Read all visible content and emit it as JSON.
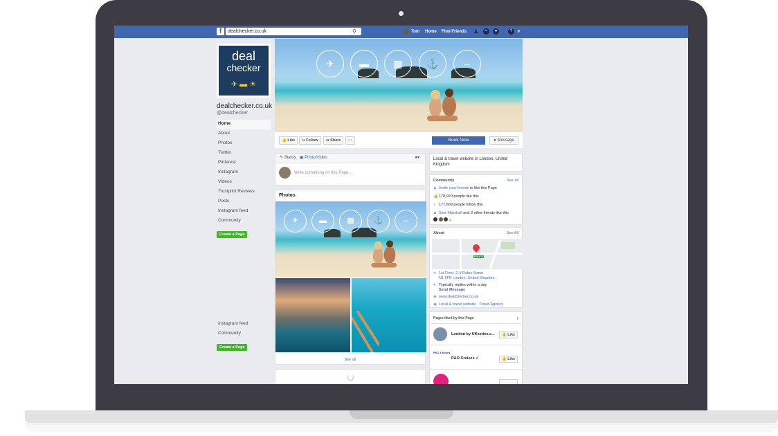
{
  "topbar": {
    "search_value": "dealchecker.co.uk",
    "user_name": "Tom",
    "home_label": "Home",
    "find_friends_label": "Find Friends"
  },
  "page": {
    "logo_line1": "deal",
    "logo_line2": "checker",
    "name": "dealchecker.co.uk",
    "handle": "@dealchecker"
  },
  "left_nav": {
    "items": [
      "Home",
      "About",
      "Photos",
      "Twitter",
      "Pinterest",
      "Instagram",
      "Videos",
      "Trustpilot Reviews",
      "Posts",
      "Instagram feed",
      "Community"
    ],
    "create_page_label": "Create a Page",
    "bottom_items": [
      "Instagram feed",
      "Community"
    ],
    "bottom_create_label": "Create a Page"
  },
  "actions": {
    "like_label": "Like",
    "follow_label": "Follow",
    "share_label": "Share",
    "more_label": "···",
    "book_now_label": "Book Now",
    "message_label": "Message"
  },
  "composer": {
    "status_tab": "Status",
    "photo_tab": "Photo/Video",
    "placeholder": "Write something on this Page..."
  },
  "photos": {
    "title": "Photos",
    "see_all": "See all"
  },
  "intro": {
    "description": "Local & travel website in London, United Kingdom"
  },
  "community": {
    "title": "Community",
    "see_all": "See all",
    "invite_link": "Invite your friends",
    "invite_rest": " to like this Page",
    "likes": "178,920 people like this",
    "follows": "177,609 people follow this",
    "friend_name": "Sam Marshall",
    "friend_rest": " and 3 other friends like this",
    "friend_extra": "4"
  },
  "about": {
    "title": "About",
    "see_all": "See All",
    "address_line1": "1st Floor, 2-4 Rufus Street",
    "address_line2": "N1 6FE London, United Kingdom",
    "reply_time": "Typically replies within a day",
    "send_message": "Send Message",
    "website": "www.dealchecker.co.uk",
    "categories": "Local & travel website · Travel Agency",
    "map_label": "Rufus St"
  },
  "liked_pages": {
    "title": "Pages liked by this Page",
    "items": [
      {
        "name": "London by UKseries.c...",
        "like_label": "Like"
      },
      {
        "name": "P&O Cruises",
        "like_label": "Like",
        "logo_text": "P&O Cruises"
      }
    ]
  },
  "colors": {
    "facebook_blue": "#4267b2",
    "create_green": "#42b72a",
    "logo_navy": "#1e3c60"
  }
}
